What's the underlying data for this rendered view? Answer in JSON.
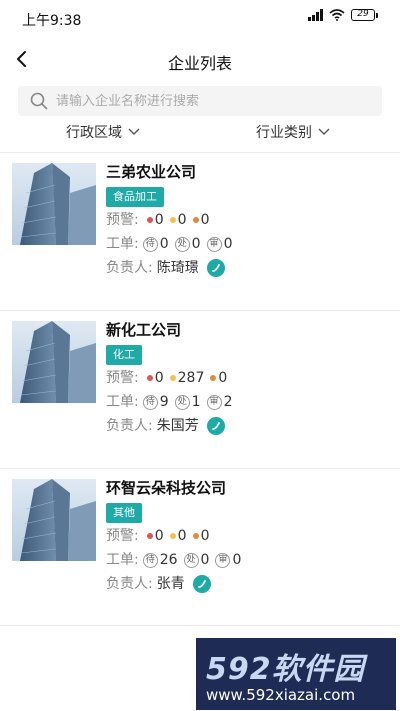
{
  "status_bar": {
    "time": "上午9:38",
    "battery": "29"
  },
  "header": {
    "title": "企业列表"
  },
  "search": {
    "placeholder": "请输入企业名称进行搜索"
  },
  "filters": {
    "region_label": "行政区域",
    "industry_label": "行业类别"
  },
  "labels": {
    "warning": "预警:",
    "workorder": "工单:",
    "manager": "负责人:",
    "pending": "待",
    "processing": "处",
    "review": "审"
  },
  "colors": {
    "accent": "#1eaaa6",
    "warn_red": "#e05555",
    "warn_yellow": "#f2c14e",
    "warn_orange": "#e8873a"
  },
  "companies": [
    {
      "name": "三弟农业公司",
      "category": "食品加工",
      "warnings": [
        "0",
        "0",
        "0"
      ],
      "orders": [
        "0",
        "0",
        "0"
      ],
      "manager": "陈琦璟"
    },
    {
      "name": "新化工公司",
      "category": "化工",
      "warnings": [
        "0",
        "287",
        "0"
      ],
      "orders": [
        "9",
        "1",
        "2"
      ],
      "manager": "朱国芳"
    },
    {
      "name": "环智云朵科技公司",
      "category": "其他",
      "warnings": [
        "0",
        "0",
        "0"
      ],
      "orders": [
        "26",
        "0",
        "0"
      ],
      "manager": "张青"
    }
  ],
  "watermark": {
    "logo": "592软件园",
    "url": "www.592xiazai.com"
  }
}
